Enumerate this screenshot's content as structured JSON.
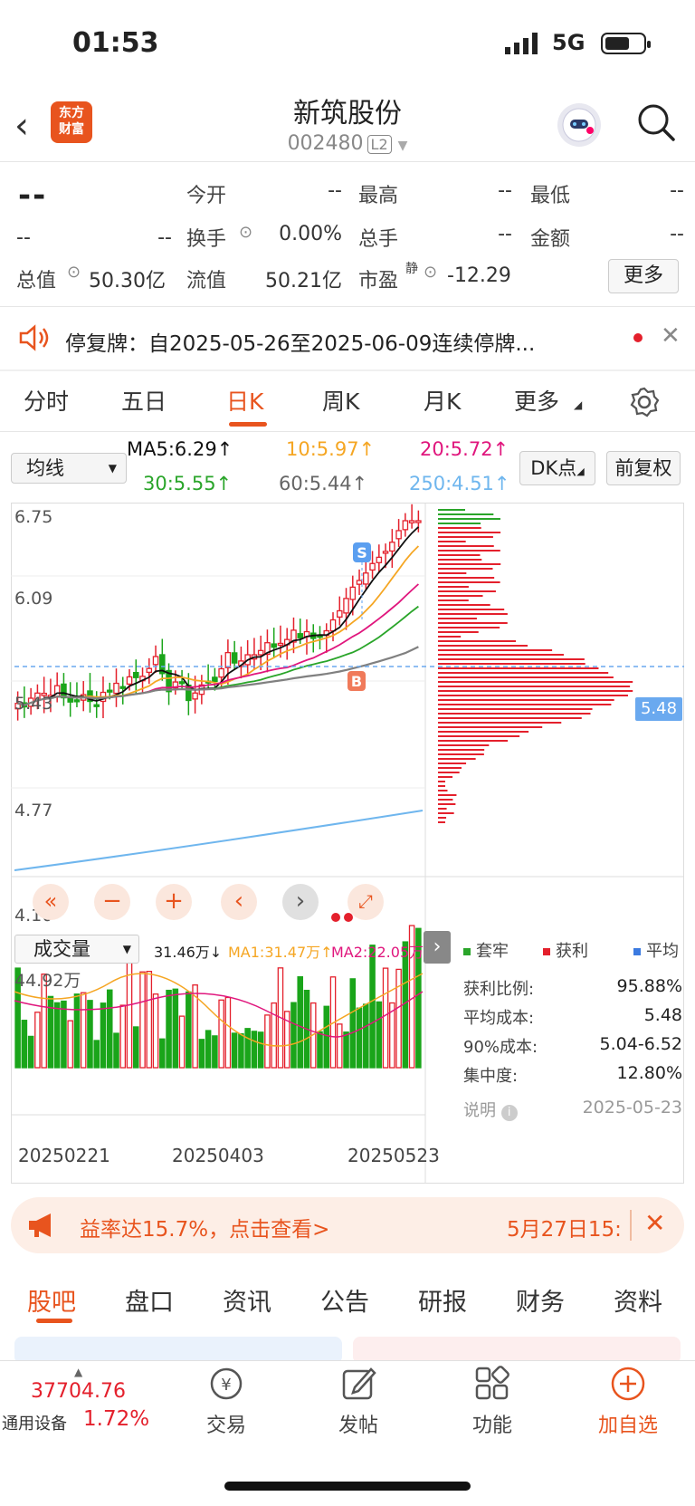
{
  "status": {
    "time": "01:53",
    "network": "5G"
  },
  "header": {
    "title": "新筑股份",
    "code": "002480",
    "level": "L2",
    "logo_text": "东方财富"
  },
  "quote": {
    "price": "--",
    "change": "--",
    "change_pct": "--",
    "rows": [
      {
        "label": "今开",
        "value": "--"
      },
      {
        "label": "最高",
        "value": "--"
      },
      {
        "label": "最低",
        "value": "--"
      },
      {
        "label": "换手",
        "value": "0.00%"
      },
      {
        "label": "总手",
        "value": "--"
      },
      {
        "label": "金额",
        "value": "--"
      },
      {
        "label": "总值",
        "value": "50.30亿"
      },
      {
        "label": "流值",
        "value": "50.21亿"
      },
      {
        "label": "市盈",
        "sup": "静",
        "value": "-12.29"
      }
    ],
    "more": "更多"
  },
  "notice": {
    "text": "停复牌：自2025-05-26至2025-06-09连续停牌..."
  },
  "ktabs": [
    "分时",
    "五日",
    "日K",
    "周K",
    "月K",
    "更多"
  ],
  "ktab_active": "日K",
  "ma": {
    "select": "均线",
    "ma5": "MA5:6.29↑",
    "ma10": "10:5.97↑",
    "ma20": "20:5.72↑",
    "ma30": "30:5.55↑",
    "ma60": "60:5.44↑",
    "ma250": "250:4.51↑",
    "dk": "DK点",
    "adjust": "前复权",
    "colors": {
      "ma5": "#111111",
      "ma10": "#f5a623",
      "ma20": "#e0167d",
      "ma30": "#2aa52a",
      "ma60": "#808080",
      "ma250": "#6fb6ee"
    }
  },
  "chart_data": {
    "type": "candlestick",
    "price_ticks": [
      "6.75",
      "6.09",
      "5.43",
      "4.77",
      "4.10"
    ],
    "chip_avg": "5.48",
    "markers": [
      "S",
      "B"
    ],
    "x_labels": [
      "20250221",
      "20250403",
      "20250523"
    ],
    "volume": {
      "select": "成交量",
      "current": "31.46万↓",
      "ma1": "MA1:31.47万↑",
      "ma2": "MA2:22.05万↑",
      "max_label": "44.92万"
    }
  },
  "chips": {
    "legend": [
      "套牢",
      "获利",
      "平均"
    ],
    "legend_colors": [
      "#2aa52a",
      "#e4202c",
      "#3b7ae0"
    ],
    "stats": [
      {
        "label": "获利比例:",
        "value": "95.88%"
      },
      {
        "label": "平均成本:",
        "value": "5.48"
      },
      {
        "label": "90%成本:",
        "value": "5.04-6.52"
      },
      {
        "label": "集中度:",
        "value": "12.80%"
      }
    ],
    "explain": "说明",
    "date": "2025-05-23"
  },
  "banner": {
    "text": "益率达15.7%，点击查看>",
    "time": "5月27日15:"
  },
  "bottom_tabs": [
    "股吧",
    "盘口",
    "资讯",
    "公告",
    "研报",
    "财务",
    "资料"
  ],
  "nav": {
    "index_value": "37704.76",
    "index_name": "通用设备",
    "index_pct": "1.72%",
    "items": [
      "交易",
      "发帖",
      "功能",
      "加自选"
    ]
  },
  "accent": "#e8541e"
}
